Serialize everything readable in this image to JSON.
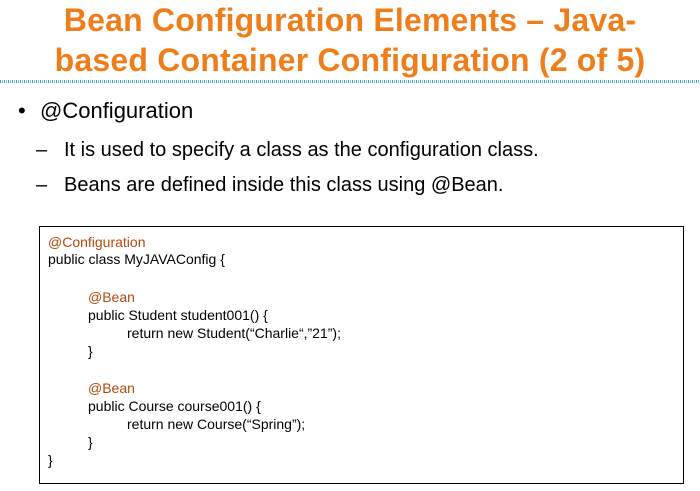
{
  "title": {
    "line1": "Bean Configuration Elements – Java-",
    "line2": "based Container Configuration (2 of 5)"
  },
  "bullets": {
    "main": "@Configuration",
    "sub": [
      "It is used to specify a class as the configuration class.",
      "Beans are defined inside this class using @Bean."
    ]
  },
  "code": {
    "lines": [
      "@Configuration",
      "public class MyJAVAConfig {",
      "@Bean",
      "public Student student001() {",
      "return new Student(“Charlie“,”21”);",
      "}",
      "@Bean",
      "public Course course001() {",
      "return new Course(“Spring”);",
      "}",
      "}"
    ]
  },
  "colors": {
    "title": "#ef7d1a",
    "annotation": "#b04a0c",
    "text": "#000000"
  }
}
